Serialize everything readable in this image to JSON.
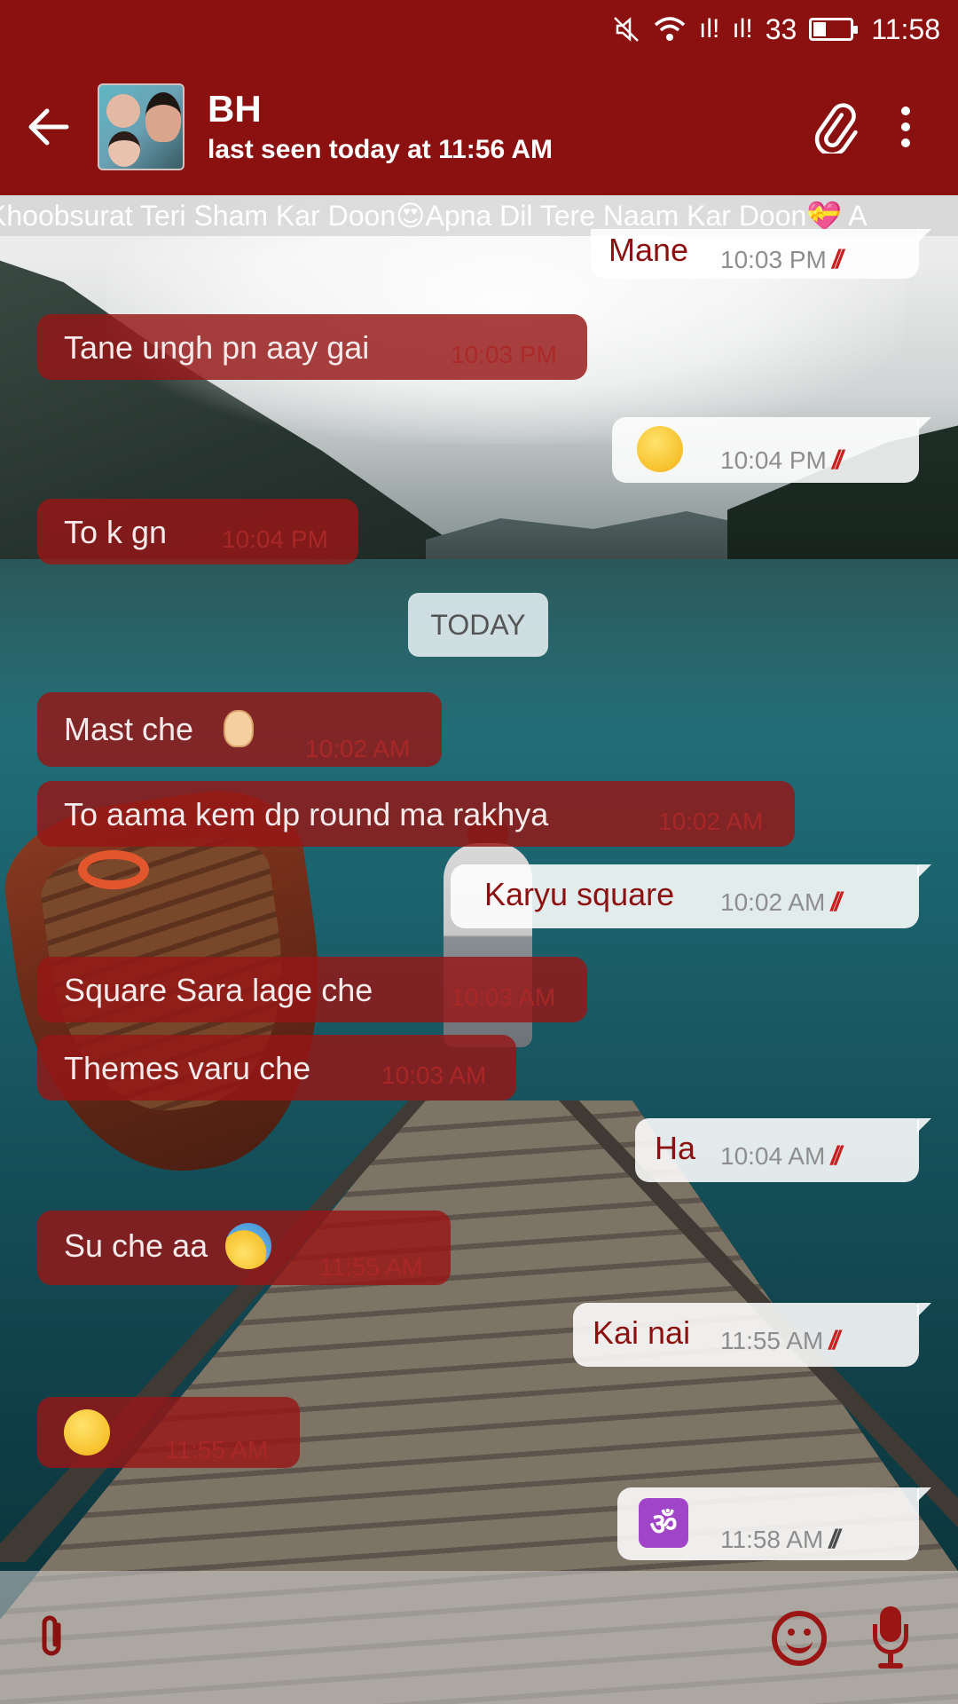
{
  "status_bar": {
    "mute_icon": "mute-icon",
    "wifi_icon": "wifi-icon",
    "signal1": "ıl!",
    "signal2": "ıl!",
    "battery_percent": "33",
    "time": "11:58"
  },
  "header": {
    "back_icon": "back-arrow-icon",
    "contact_name": "BH",
    "last_seen": "last seen today at 11:56 AM",
    "attach_icon": "paperclip-icon",
    "menu_icon": "more-vert-icon"
  },
  "marquee": {
    "text": "Khoobsurat Teri Sham Kar Doon😍Apna Dil Tere Naam Kar Doon💝 A"
  },
  "colors": {
    "primary": "#8b1111",
    "incoming_bubble": "rgba(150,22,22,0.82)",
    "outgoing_bubble": "rgba(255,255,255,0.88)",
    "tick_red": "#c82020"
  },
  "messages": [
    {
      "dir": "out",
      "text": "Mane",
      "time": "10:03 PM",
      "ticks": "//"
    },
    {
      "dir": "in",
      "text": "Tane ungh pn aay gai",
      "time": "10:03 PM"
    },
    {
      "dir": "out",
      "emoji": "dizzy-face-emoji",
      "text": "",
      "time": "10:04 PM",
      "ticks": "//"
    },
    {
      "dir": "in",
      "text": "To k gn",
      "time": "10:04 PM"
    },
    {
      "dir": "in",
      "text": "Mast che",
      "emoji": "ok-hand-emoji",
      "time": "10:02 AM"
    },
    {
      "dir": "in",
      "text": "To aama kem dp round ma rakhya",
      "time": "10:02 AM"
    },
    {
      "dir": "out",
      "text": "Karyu square",
      "time": "10:02 AM",
      "ticks": "//"
    },
    {
      "dir": "in",
      "text": "Square Sara lage che",
      "time": "10:03 AM"
    },
    {
      "dir": "in",
      "text": "Themes varu che",
      "time": "10:03 AM"
    },
    {
      "dir": "out",
      "text": "Ha",
      "time": "10:04 AM",
      "ticks": "//"
    },
    {
      "dir": "in",
      "text": "Su che aa",
      "emoji": "anxious-sweat-emoji",
      "time": "11:55 AM"
    },
    {
      "dir": "out",
      "text": "Kai nai",
      "time": "11:55 AM",
      "ticks": "//"
    },
    {
      "dir": "in",
      "emoji": "kissing-heart-emoji",
      "text": "",
      "time": "11:55 AM"
    },
    {
      "dir": "out",
      "emoji": "om-icon",
      "om_glyph": "ॐ",
      "text": "",
      "time": "11:58 AM",
      "ticks": "//"
    }
  ],
  "date_divider": "TODAY",
  "input_bar": {
    "attach_icon": "paperclip-icon",
    "emoji_icon": "smiley-icon",
    "mic_icon": "microphone-icon"
  }
}
